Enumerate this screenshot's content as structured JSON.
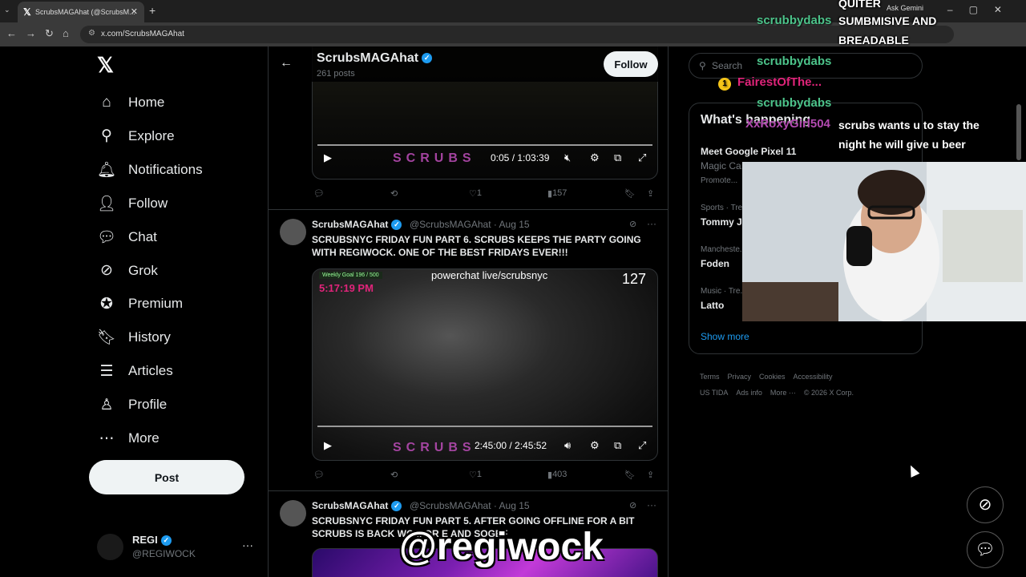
{
  "browser": {
    "tab_title": "ScrubsMAGAhat (@ScrubsM...",
    "url": "x.com/ScrubsMAGAhat",
    "gemini_label": "Ask Gemini",
    "profile_letter": "A"
  },
  "nav": {
    "items": [
      {
        "label": "Home",
        "icon": "⌂"
      },
      {
        "label": "Explore",
        "icon": "⚲"
      },
      {
        "label": "Notifications",
        "icon": "🔔︎"
      },
      {
        "label": "Follow",
        "icon": "👤︎"
      },
      {
        "label": "Chat",
        "icon": "💬︎"
      },
      {
        "label": "Grok",
        "icon": "⊘"
      },
      {
        "label": "Premium",
        "icon": "✪"
      },
      {
        "label": "History",
        "icon": "🔖︎"
      },
      {
        "label": "Articles",
        "icon": "☰"
      },
      {
        "label": "Profile",
        "icon": "♙"
      },
      {
        "label": "More",
        "icon": "⋯"
      }
    ],
    "post_label": "Post",
    "account_name": "REGI",
    "account_handle": "@REGIWOCK"
  },
  "profile": {
    "name": "ScrubsMAGAhat",
    "post_count": "261 posts",
    "follow_label": "Follow"
  },
  "tweets": [
    {
      "video_time": "0:05 / 1:03:39",
      "replies": "",
      "likes": "1",
      "views": "157"
    },
    {
      "name": "ScrubsMAGAhat",
      "handle": "@ScrubsMAGAhat · Aug 15",
      "text": "SCRUBSNYC FRIDAY FUN PART 6. SCRUBS KEEPS THE PARTY GOING WITH REGIWOCK. ONE OF THE BEST FRIDAYS EVER!!!",
      "stream_badge": "powerchat live/scrubsnyc",
      "stream_timer": "5:17:19 PM",
      "goal_text": "Weekly Goal 196 / 500",
      "video_time": "2:45:00 / 2:45:52",
      "likes": "1",
      "views": "403"
    },
    {
      "name": "ScrubsMAGAhat",
      "handle": "@ScrubsMAGAhat · Aug 15",
      "text": "SCRUBSNYC FRIDAY FUN PART 5. AFTER GOING OFFLINE FOR A BIT SCRUBS IS BACK WO... OR E AND SOGEF"
    }
  ],
  "sidebar": {
    "search_placeholder": "Search",
    "whats_happening": "What's happening",
    "trends": [
      {
        "context": "",
        "name": "Meet Google Pixel 11",
        "sub": "Magic Ca...",
        "promo": "Promote..."
      },
      {
        "context": "Sports · Tre...",
        "name": "Tommy J..."
      },
      {
        "context": "Mancheste...",
        "name": "Foden"
      },
      {
        "context": "Music · Tre...",
        "name": "Latto"
      }
    ],
    "show_more": "Show more",
    "footer": [
      "Terms",
      "Privacy",
      "Cookies",
      "Accessibility",
      "US TIDA",
      "Ads info",
      "More ···",
      "© 2026 X Corp."
    ]
  },
  "chat": {
    "lines": [
      {
        "user": "scrubbydabs",
        "msg": "QUITER"
      },
      {
        "user": "",
        "msg": "SUMBMISIVE AND"
      },
      {
        "user": "",
        "msg": "BREADABLE"
      },
      {
        "user": "scrubbydabs",
        "msg": ""
      },
      {
        "user": "FairestOfThe...",
        "msg": ""
      },
      {
        "user": "scrubbydabs",
        "msg": "scrubs wants u to stay the"
      },
      {
        "user": "XxRoxyGirl504",
        "msg": "night he will give u beer"
      }
    ]
  },
  "overlay_text": "@regiwock",
  "watermark": "SCRUBS",
  "stream_count": "127"
}
